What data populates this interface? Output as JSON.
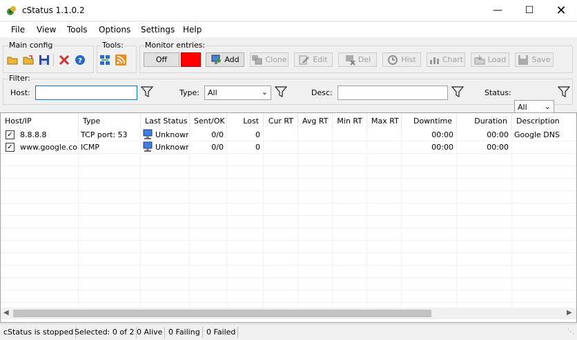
{
  "window": {
    "title": "cStatus 1.1.0.2"
  },
  "menu": [
    "File",
    "View",
    "Tools",
    "Options",
    "Settings",
    "Help"
  ],
  "toolbar": {
    "main_config_label": "Main config",
    "tools_label": "Tools:",
    "monitor_label": "Monitor entries:",
    "off_label": "Off",
    "status_color": "#ff0000",
    "add": "Add",
    "clone": "Clone",
    "edit": "Edit",
    "del": "Del",
    "hist": "Hist",
    "chart": "Chart",
    "load": "Load",
    "save": "Save"
  },
  "filter": {
    "label": "Filter:",
    "host_label": "Host:",
    "host_value": "",
    "type_label": "Type:",
    "type_value": "All",
    "desc_label": "Desc:",
    "desc_value": "",
    "status_label": "Status:",
    "status_value": "All"
  },
  "table": {
    "columns": [
      "Host/IP",
      "Type",
      "Last Status",
      "Sent/OK",
      "Lost",
      "Cur RT",
      "Avg RT",
      "Min RT",
      "Max RT",
      "Downtime",
      "Duration",
      "Description"
    ],
    "rows": [
      {
        "checked": true,
        "host": "8.8.8.8",
        "type": "TCP port: 53",
        "status": "Unknown",
        "sent": "0/0",
        "lost": "0",
        "cur": "",
        "avg": "",
        "min": "",
        "max": "",
        "downtime": "00:00",
        "duration": "00:00",
        "desc": "Google DNS"
      },
      {
        "checked": true,
        "host": "www.google.com",
        "type": "ICMP",
        "status": "Unknown",
        "sent": "0/0",
        "lost": "0",
        "cur": "",
        "avg": "",
        "min": "",
        "max": "",
        "downtime": "00:00",
        "duration": "00:00",
        "desc": ""
      }
    ]
  },
  "statusbar": {
    "state": "cStatus is stopped",
    "selected": "Selected: 0 of 2",
    "alive": "0 Alive",
    "failing": "0 Failing",
    "failed": "0 Failed"
  }
}
